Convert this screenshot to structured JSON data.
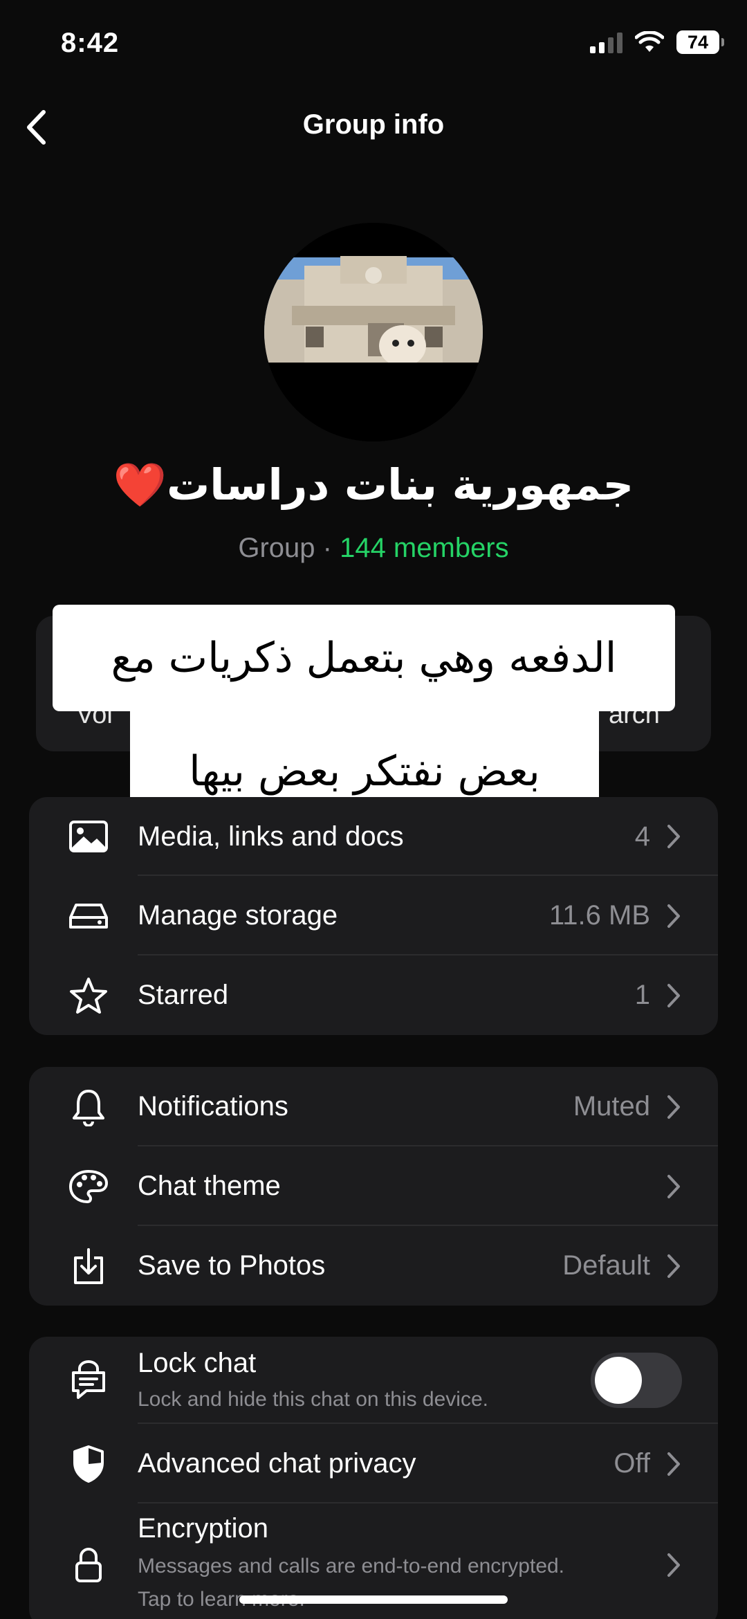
{
  "status_bar": {
    "time": "8:42",
    "battery": "74"
  },
  "nav": {
    "title": "Group info"
  },
  "group": {
    "name": "جمهورية بنات دراسات❤️",
    "meta_prefix": "Group · ",
    "members": "144 members"
  },
  "actions": {
    "left_partial": "Voi",
    "right_partial": "arch"
  },
  "caption": {
    "line1": "الدفعه وهي بتعمل ذكريات مع",
    "line2": "بعض نفتكر بعض بيها"
  },
  "section1": [
    {
      "icon": "photo-icon",
      "label": "Media, links and docs",
      "value": "4"
    },
    {
      "icon": "storage-icon",
      "label": "Manage storage",
      "value": "11.6 MB"
    },
    {
      "icon": "star-icon",
      "label": "Starred",
      "value": "1"
    }
  ],
  "section2": [
    {
      "icon": "bell-icon",
      "label": "Notifications",
      "value": "Muted"
    },
    {
      "icon": "palette-icon",
      "label": "Chat theme",
      "value": ""
    },
    {
      "icon": "download-icon",
      "label": "Save to Photos",
      "value": "Default"
    }
  ],
  "section3": {
    "lock_chat": {
      "icon": "lock-chat-icon",
      "label": "Lock chat",
      "sub": "Lock and hide this chat on this device.",
      "enabled": false
    },
    "advanced_privacy": {
      "icon": "shield-icon",
      "label": "Advanced chat privacy",
      "value": "Off"
    },
    "encryption": {
      "icon": "lock-icon",
      "label": "Encryption",
      "sub1": "Messages and calls are end-to-end encrypted.",
      "sub2": "Tap to learn more."
    }
  }
}
